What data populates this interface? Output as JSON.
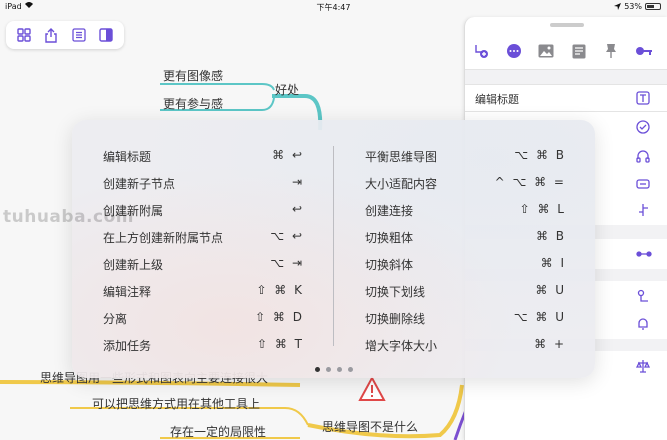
{
  "status_bar": {
    "device": "iPad",
    "time": "下午4:47",
    "battery": "53%"
  },
  "toolbar": {
    "icons": [
      "grid-icon",
      "share-icon",
      "outline-icon",
      "sidebar-icon"
    ]
  },
  "mindmap": {
    "branch_label": "好处",
    "children": [
      "更有图像感",
      "更有参与感"
    ],
    "bottom_branch_label": "思维导图不是什么",
    "bottom_children": [
      "思维导图用一些形式和图表向主要连接很大",
      "可以把思维方式用在其他工具上",
      "存在一定的局限性"
    ],
    "colors": {
      "teal": "#5cc6c6",
      "yellow": "#f0c94a",
      "purple": "#7b4fd0"
    }
  },
  "panel": {
    "edit_title_label": "编辑标题",
    "icons": [
      "add-node-icon",
      "more-icon",
      "image-icon",
      "note-icon",
      "pin-icon",
      "key-icon"
    ],
    "accent": "#6b4fd8"
  },
  "shortcuts": {
    "left": [
      {
        "name": "编辑标题",
        "keys": "⌘ ↩"
      },
      {
        "name": "创建新子节点",
        "keys": "⇥"
      },
      {
        "name": "创建新附属",
        "keys": "↩"
      },
      {
        "name": "在上方创建新附属节点",
        "keys": "⌥ ↩"
      },
      {
        "name": "创建新上级",
        "keys": "⌥ ⇥"
      },
      {
        "name": "编辑注释",
        "keys": "⇧ ⌘ K"
      },
      {
        "name": "分离",
        "keys": "⇧ ⌘ D"
      },
      {
        "name": "添加任务",
        "keys": "⇧ ⌘ T"
      }
    ],
    "right": [
      {
        "name": "平衡思维导图",
        "keys": "⌥ ⌘ B"
      },
      {
        "name": "大小适配内容",
        "keys": "^ ⌥ ⌘ ="
      },
      {
        "name": "创建连接",
        "keys": "⇧ ⌘ L"
      },
      {
        "name": "切换粗体",
        "keys": "⌘ B"
      },
      {
        "name": "切换斜体",
        "keys": "⌘ I"
      },
      {
        "name": "切换下划线",
        "keys": "⌘ U"
      },
      {
        "name": "切换删除线",
        "keys": "⌥ ⌘ U"
      },
      {
        "name": "增大字体大小",
        "keys": "⌘ +"
      }
    ],
    "page_count": 4,
    "current_page": 1
  },
  "watermark": "tuhuaba.com"
}
